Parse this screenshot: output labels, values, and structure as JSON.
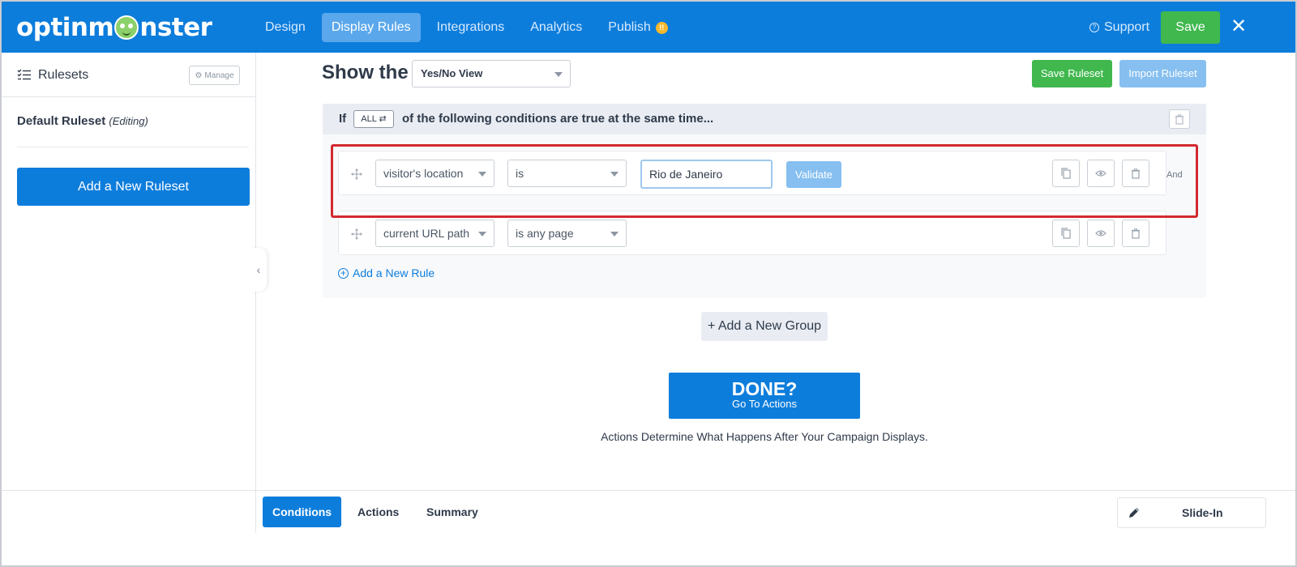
{
  "app": {
    "logo_text_left": "optinm",
    "logo_text_right": "nster"
  },
  "nav": {
    "items": [
      {
        "label": "Design"
      },
      {
        "label": "Display Rules"
      },
      {
        "label": "Integrations"
      },
      {
        "label": "Analytics"
      },
      {
        "label": "Publish"
      }
    ],
    "publish_badge": "!!",
    "support_label": "Support",
    "save_label": "Save"
  },
  "sidebar": {
    "title": "Rulesets",
    "manage_label": "Manage",
    "default_ruleset_name": "Default Ruleset",
    "default_ruleset_status": "(Editing)",
    "add_ruleset_label": "Add a New Ruleset"
  },
  "main": {
    "show_the_label": "Show the",
    "view_select_value": "Yes/No View",
    "save_ruleset_label": "Save Ruleset",
    "import_ruleset_label": "Import Ruleset",
    "group": {
      "if_label": "If",
      "match_mode": "ALL ⇄",
      "condition_text": "of the following conditions are true at the same time...",
      "rules": [
        {
          "field": "visitor's location",
          "operator": "is",
          "value": "Rio de Janeiro",
          "validate_label": "Validate",
          "connector": "And"
        },
        {
          "field": "current URL path",
          "operator": "is any page"
        }
      ],
      "add_rule_label": "Add a New Rule"
    },
    "add_group_label": "+ Add a New Group",
    "done_title": "DONE?",
    "done_subtitle": "Go To Actions",
    "actions_note": "Actions Determine What Happens After Your Campaign Displays."
  },
  "bottom": {
    "tabs": [
      {
        "label": "Conditions"
      },
      {
        "label": "Actions"
      },
      {
        "label": "Summary"
      }
    ],
    "campaign_type": "Slide-In"
  },
  "colors": {
    "brand_blue": "#0d7ddc",
    "success_green": "#40b84e",
    "highlight_red": "#d22a2f"
  }
}
